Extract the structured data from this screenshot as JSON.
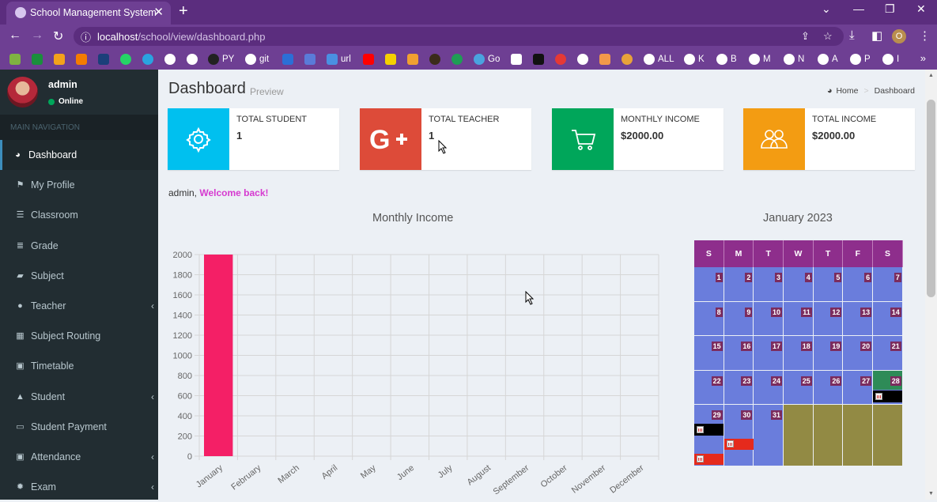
{
  "browser": {
    "tab_title": "School Management System",
    "new_tab": "+",
    "url_host": "localhost",
    "url_path": "/school/view/dashboard.php",
    "profile_initial": "O",
    "bookmarks": [
      "PY",
      "git",
      "url",
      "Go",
      "ALL",
      "K",
      "B",
      "M",
      "N",
      "A",
      "P",
      "I"
    ]
  },
  "sidebar": {
    "user_name": "admin",
    "status": "Online",
    "nav_header": "MAIN NAVIGATION",
    "items": [
      {
        "label": "Dashboard",
        "icon": "dashboard-icon"
      },
      {
        "label": "My Profile",
        "icon": "flag-icon"
      },
      {
        "label": "Classroom",
        "icon": "list-icon"
      },
      {
        "label": "Grade",
        "icon": "database-icon"
      },
      {
        "label": "Subject",
        "icon": "book-icon"
      },
      {
        "label": "Teacher",
        "icon": "user-icon"
      },
      {
        "label": "Subject Routing",
        "icon": "grid-icon"
      },
      {
        "label": "Timetable",
        "icon": "calendar-icon"
      },
      {
        "label": "Student",
        "icon": "graduation-cap-icon"
      },
      {
        "label": "Student Payment",
        "icon": "money-icon"
      },
      {
        "label": "Attendance",
        "icon": "calendar-check-icon"
      },
      {
        "label": "Exam",
        "icon": "exam-icon"
      }
    ]
  },
  "header": {
    "title": "Dashboard",
    "subtitle": "Preview",
    "breadcrumb_home": "Home",
    "breadcrumb_current": "Dashboard"
  },
  "stats": [
    {
      "label": "TOTAL STUDENT",
      "value": "1",
      "color": "#00c0ef",
      "icon": "gear-icon"
    },
    {
      "label": "TOTAL TEACHER",
      "value": "1",
      "color": "#dd4b39",
      "icon": "google-plus-icon"
    },
    {
      "label": "MONTHLY INCOME",
      "value": "$2000.00",
      "color": "#00a65a",
      "icon": "cart-icon"
    },
    {
      "label": "TOTAL INCOME",
      "value": "$2000.00",
      "color": "#f39c12",
      "icon": "users-icon"
    }
  ],
  "welcome": {
    "user": "admin,",
    "message": "Welcome back!"
  },
  "chart_title": "Monthly Income",
  "chart_data": {
    "type": "bar",
    "categories": [
      "January",
      "February",
      "March",
      "April",
      "May",
      "June",
      "July",
      "August",
      "September",
      "October",
      "November",
      "December"
    ],
    "values": [
      2000,
      0,
      0,
      0,
      0,
      0,
      0,
      0,
      0,
      0,
      0,
      0
    ],
    "ylim": [
      0,
      2000
    ],
    "yticks": [
      0,
      200,
      400,
      600,
      800,
      1000,
      1200,
      1400,
      1600,
      1800,
      2000
    ],
    "bar_color": "#f41f66",
    "grid": true
  },
  "calendar": {
    "title": "January 2023",
    "weekdays": [
      "S",
      "M",
      "T",
      "W",
      "T",
      "F",
      "S"
    ],
    "weeks": [
      [
        "1",
        "2",
        "3",
        "4",
        "5",
        "6",
        "7"
      ],
      [
        "8",
        "9",
        "10",
        "11",
        "12",
        "13",
        "14"
      ],
      [
        "15",
        "16",
        "17",
        "18",
        "19",
        "20",
        "21"
      ],
      [
        "22",
        "23",
        "24",
        "25",
        "26",
        "27",
        "28"
      ],
      [
        "29",
        "30",
        "31",
        "",
        "",
        "",
        ""
      ]
    ],
    "cell_color": "#6a7ddc",
    "header_color": "#8e2e8c"
  }
}
